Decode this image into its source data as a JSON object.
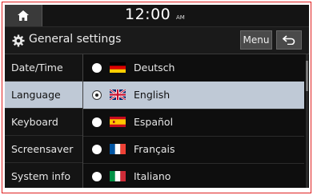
{
  "statusbar": {
    "time": "12:00",
    "ampm": "AM"
  },
  "header": {
    "title": "General settings",
    "menu_label": "Menu"
  },
  "sidebar": {
    "items": [
      {
        "label": "Date/Time"
      },
      {
        "label": "Language"
      },
      {
        "label": "Keyboard"
      },
      {
        "label": "Screensaver"
      },
      {
        "label": "System info"
      }
    ]
  },
  "languages": {
    "selected": "English",
    "options": [
      {
        "label": "Deutsch",
        "flag": "germany-flag-icon"
      },
      {
        "label": "English",
        "flag": "uk-flag-icon"
      },
      {
        "label": "Español",
        "flag": "spain-flag-icon"
      },
      {
        "label": "Français",
        "flag": "france-flag-icon"
      },
      {
        "label": "Italiano",
        "flag": "italy-flag-icon"
      }
    ]
  },
  "colors": {
    "selected_row": "#bfc9d6",
    "background": "#0c0c0c",
    "frame": "#e02020"
  }
}
